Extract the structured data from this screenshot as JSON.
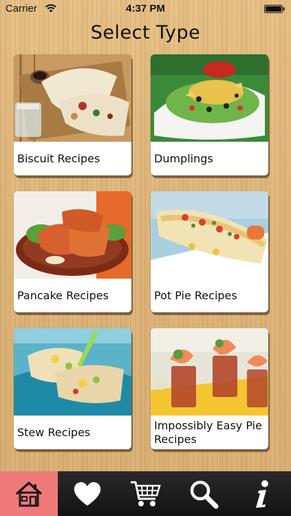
{
  "status_bar": {
    "carrier": "Carrier",
    "time": "4:37 PM"
  },
  "header": {
    "title": "Select Type"
  },
  "cards": [
    {
      "label": "Biscuit Recipes"
    },
    {
      "label": "Dumplings"
    },
    {
      "label": "Pancake Recipes"
    },
    {
      "label": "Pot Pie Recipes"
    },
    {
      "label": "Stew Recipes"
    },
    {
      "label": "Impossibly Easy Pie Recipes"
    }
  ],
  "tab_bar": {
    "active": "home",
    "tabs": [
      {
        "icon": "home-icon"
      },
      {
        "icon": "heart-icon"
      },
      {
        "icon": "cart-icon"
      },
      {
        "icon": "search-icon"
      },
      {
        "icon": "info-icon"
      }
    ]
  },
  "colors": {
    "active_tab": "#f07a7a",
    "tab_bar": "#1a1a1a",
    "card_label_bg": "#ffffff"
  }
}
